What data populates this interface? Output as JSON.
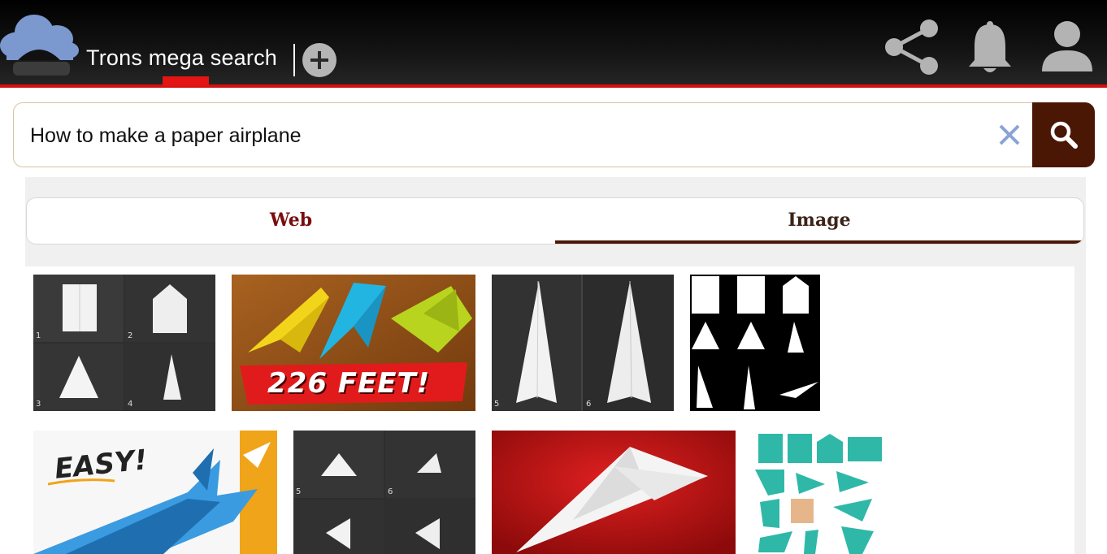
{
  "header": {
    "app_title": "Trons mega search",
    "icons": [
      "cloud-logo-icon",
      "add-tab-icon",
      "share-icon",
      "bell-icon",
      "user-icon"
    ],
    "accent_color": "#e31414"
  },
  "search": {
    "query": "How to make a paper airplane",
    "button_color": "#4b1705"
  },
  "tabs": {
    "items": [
      "Web",
      "Image"
    ],
    "active": "Image"
  },
  "results": {
    "images": [
      {
        "text": "",
        "steps": [
          "1",
          "2",
          "3",
          "4"
        ]
      },
      {
        "text": "226 FEET!"
      },
      {
        "text": "",
        "steps": [
          "5",
          "6"
        ]
      },
      {
        "text": ""
      },
      {
        "text": "EASY!"
      },
      {
        "text": "",
        "steps": [
          "5",
          "6"
        ]
      },
      {
        "text": ""
      },
      {
        "text": ""
      }
    ]
  }
}
